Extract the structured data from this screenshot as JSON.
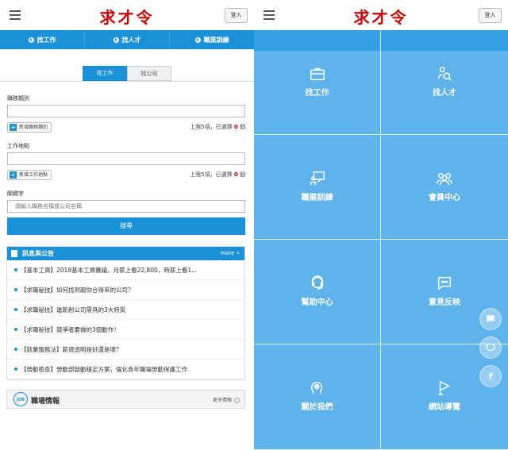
{
  "header": {
    "logo": "求才令",
    "login": "登入"
  },
  "nav": [
    {
      "label": "找工作"
    },
    {
      "label": "找人才"
    },
    {
      "label": "職業訓練"
    }
  ],
  "search": {
    "tabs": [
      "找工作",
      "找公司"
    ],
    "job_category_label": "職務類別",
    "add_category_btn": "新增職務類別",
    "category_quota": "上限5項，已選擇",
    "category_count": "0",
    "unit": "個",
    "location_label": "工作地點",
    "add_location_btn": "新增工作地點",
    "location_quota": "上限5項，已選擇",
    "location_count": "0",
    "keyword_label": "關鍵字",
    "keyword_placeholder": "請輸入職務名稱或公司名稱",
    "search_button": "搜尋"
  },
  "news": {
    "title": "訊息與公告",
    "more": "more »",
    "items": [
      "【基本工資】2018基本工資審議，月薪上看22,800，時薪上看1...",
      "【求職秘技】如何找到跟你合得來的公司？",
      "【求職秘技】進新創公司需具的3大特質",
      "【求職秘技】競爭者要做的3個動作！",
      "【就業服務法】薪資透明是好還是壞？",
      "【勞動檢查】勞動部啟動穩定方案，強化青年職場勞動保護工作"
    ]
  },
  "job_market": {
    "icon_text": "JOB",
    "title": "職場情報",
    "more": "更多情報"
  },
  "menu": {
    "tiles": [
      {
        "label": "找工作",
        "icon": "briefcase-icon"
      },
      {
        "label": "找人才",
        "icon": "person-search-icon"
      },
      {
        "label": "職業訓練",
        "icon": "training-icon"
      },
      {
        "label": "會員中心",
        "icon": "members-icon"
      },
      {
        "label": "幫助中心",
        "icon": "help-icon"
      },
      {
        "label": "意見反映",
        "icon": "feedback-icon"
      },
      {
        "label": "關於我們",
        "icon": "about-icon"
      },
      {
        "label": "網站導覽",
        "icon": "flag-icon"
      }
    ]
  },
  "side_buttons": [
    {
      "icon": "chat-icon"
    },
    {
      "icon": "line-icon"
    },
    {
      "icon": "facebook-icon",
      "text": "f"
    }
  ],
  "colors": {
    "brand_red": "#c40000",
    "accent_blue": "#1a91d8",
    "overlay_blue": "#3ba2e6"
  }
}
